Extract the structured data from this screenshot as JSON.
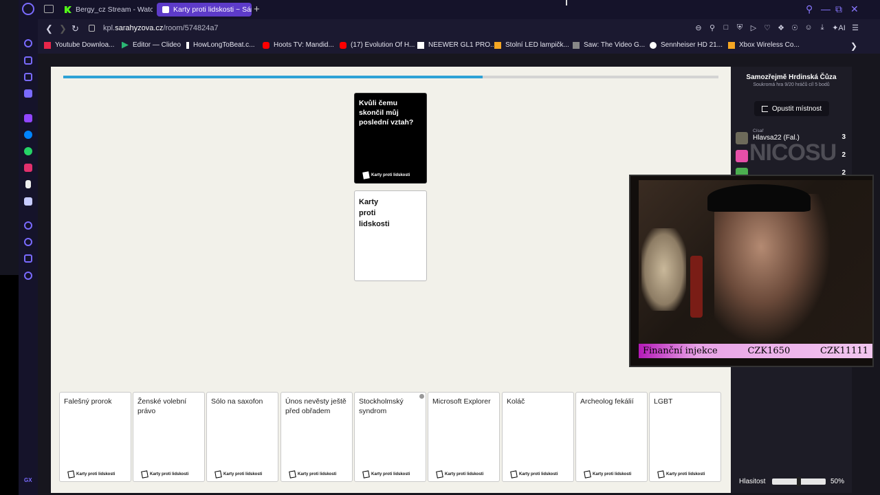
{
  "browser": {
    "tabs": [
      {
        "label": "Bergy_cz Stream - Watch L",
        "active": false
      },
      {
        "label": "Karty proti lidskosti ~ Sára",
        "active": true
      }
    ],
    "url_prefix": "kpl.",
    "url_domain": "sarahyzova.cz",
    "url_path": "/room/574824a7",
    "bookmarks": [
      {
        "label": "Youtube Downloa...",
        "icon_color": "#e8264a"
      },
      {
        "label": "Editor — Clideo",
        "icon_color": "#2bb673"
      },
      {
        "label": "HowLongToBeat.c...",
        "icon_color": "#ffffff"
      },
      {
        "label": "Hoots TV: Mandid...",
        "icon_color": "#ff0000"
      },
      {
        "label": "(17) Evolution Of H...",
        "icon_color": "#ff0000"
      },
      {
        "label": "NEEWER GL1 PRO...",
        "icon_color": "#ffffff"
      },
      {
        "label": "Stolní LED lampičk...",
        "icon_color": "#f5a623"
      },
      {
        "label": "Saw: The Video G...",
        "icon_color": "#888888"
      },
      {
        "label": "Sennheiser HD 21...",
        "icon_color": "#ffffff"
      },
      {
        "label": "Xbox Wireless Co...",
        "icon_color": "#f5a623"
      }
    ],
    "accent": "#7a6bff"
  },
  "game": {
    "progress_fraction": 0.64,
    "black_card": {
      "text": "Kvůli čemu skončil můj poslední vztah?",
      "brand": "Karty proti lidskosti"
    },
    "played_card": {
      "line1": "Karty",
      "line2": "proti",
      "line3": "lidskosti"
    },
    "hand": [
      {
        "text": "Falešný prorok"
      },
      {
        "text": "Ženské volební právo"
      },
      {
        "text": "Sólo na saxofon"
      },
      {
        "text": "Únos nevěsty ještě před obřadem"
      },
      {
        "text": "Stockholmský syndrom"
      },
      {
        "text": "Microsoft Explorer"
      },
      {
        "text": "Koláč"
      },
      {
        "text": "Archeolog fekálií"
      },
      {
        "text": "LGBT"
      }
    ],
    "brand": "Karty proti lidskosti"
  },
  "panel": {
    "room_name": "Samozřejmě Hrdinská Čůza",
    "room_meta": "Soukromá hra   9/20 hráčů   cíl 5 bodů",
    "leave_label": "Opustit místnost",
    "players": [
      {
        "role": "Císař",
        "name": "Hlavsa22 (Fal.)",
        "points": "3"
      },
      {
        "role": "",
        "name": "",
        "points": "2"
      },
      {
        "role": "",
        "name": "",
        "points": "2"
      }
    ],
    "volume_label": "Hlasitost",
    "volume_value": "50%",
    "volume_fraction": 0.5
  },
  "stream_overlay": {
    "watermark": "NICOSU",
    "label": "Finanční injekce",
    "amount1": "CZK1650",
    "amount2": "CZK11111"
  }
}
